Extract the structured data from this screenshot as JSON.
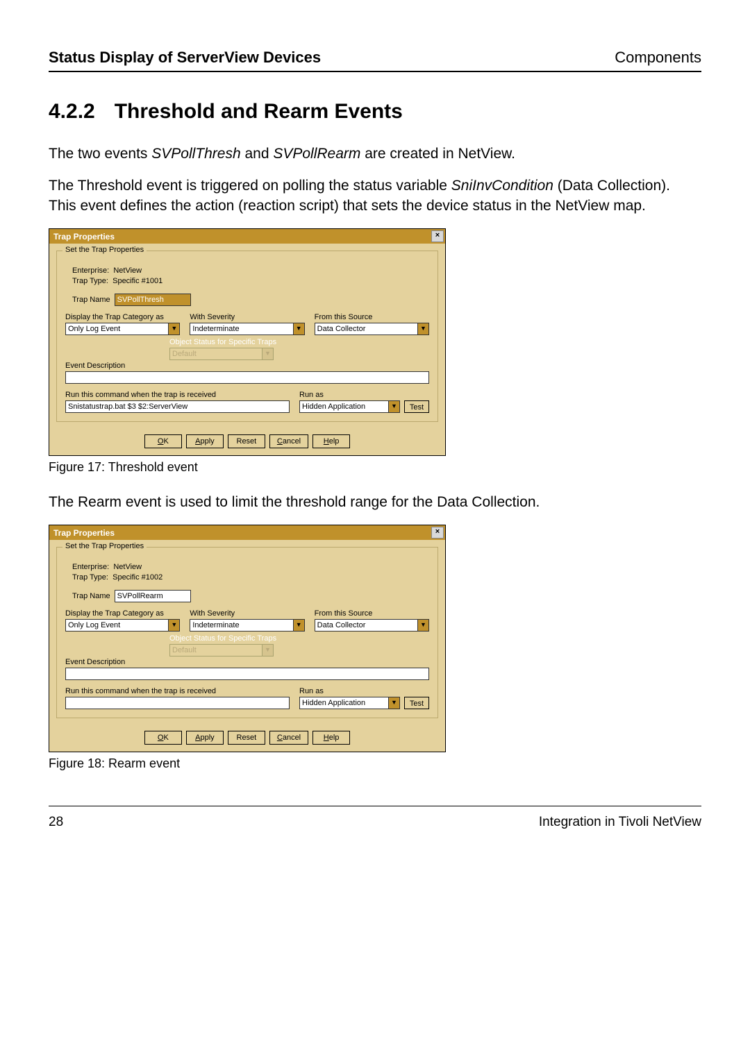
{
  "header": {
    "left": "Status Display of ServerView Devices",
    "right": "Components"
  },
  "section": {
    "number": "4.2.2",
    "title": "Threshold and Rearm Events"
  },
  "para1_pre": "The two events ",
  "para1_e1": "SVPollThresh",
  "para1_mid": " and ",
  "para1_e2": "SVPollRearm",
  "para1_post": " are created in NetView.",
  "para2_pre": "The Threshold event is triggered on polling the status variable ",
  "para2_e1": "SniInvCondition",
  "para2_post": " (Data Collection). This event defines the action (reaction script) that sets the device status in the NetView map.",
  "fig17_caption": "Figure 17: Threshold event",
  "para3": "The Rearm event is used to limit the threshold range for the Data Collection.",
  "fig18_caption": "Figure 18: Rearm event",
  "dialog_common": {
    "title": "Trap Properties",
    "groupbox": "Set the Trap Properties",
    "enterprise_label": "Enterprise:",
    "enterprise_value": "NetView",
    "trap_type_label": "Trap Type:",
    "trap_name_label": "Trap Name",
    "display_category_label": "Display the Trap Category as",
    "with_severity_label": "With Severity",
    "from_source_label": "From this Source",
    "display_category_value": "Only Log Event",
    "with_severity_value": "Indeterminate",
    "from_source_value": "Data Collector",
    "object_status_label": "Object Status for Specific Traps",
    "object_status_value": "Default",
    "event_desc_label": "Event Description",
    "run_cmd_label": "Run this command when the trap is received",
    "run_as_label": "Run as",
    "run_as_value": "Hidden Application",
    "test_btn": "Test",
    "ok": "OK",
    "apply": "Apply",
    "reset": "Reset",
    "cancel": "Cancel",
    "help": "Help"
  },
  "dialog1": {
    "trap_type_value": "Specific #1001",
    "trap_name_value": "SVPollThresh",
    "run_cmd_value": "Snistatustrap.bat $3 $2:ServerView"
  },
  "dialog2": {
    "trap_type_value": "Specific #1002",
    "trap_name_value": "SVPollRearm",
    "run_cmd_value": ""
  },
  "footer": {
    "page": "28",
    "right": "Integration in Tivoli NetView"
  }
}
